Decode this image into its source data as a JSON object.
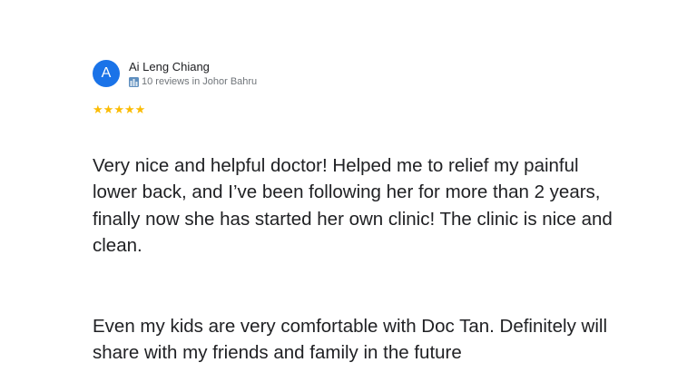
{
  "reviewer": {
    "avatar_letter": "A",
    "avatar_color": "#1a73e8",
    "name": "Ai Leng Chiang",
    "subtitle": "10 reviews in Johor Bahru",
    "subtitle_icon": "local-guide-icon"
  },
  "rating": {
    "stars": 5,
    "star_glyph": "★",
    "star_color": "#fbbc04"
  },
  "review": {
    "paragraph_1": "Very nice and helpful doctor! Helped me to relief my painful lower back, and I’ve been following her for more than 2 years, finally now she has started her own clinic! The clinic is nice and clean.",
    "paragraph_2": "Even my kids are very comfortable with Doc Tan. Definitely will share with my friends and family in the future"
  }
}
